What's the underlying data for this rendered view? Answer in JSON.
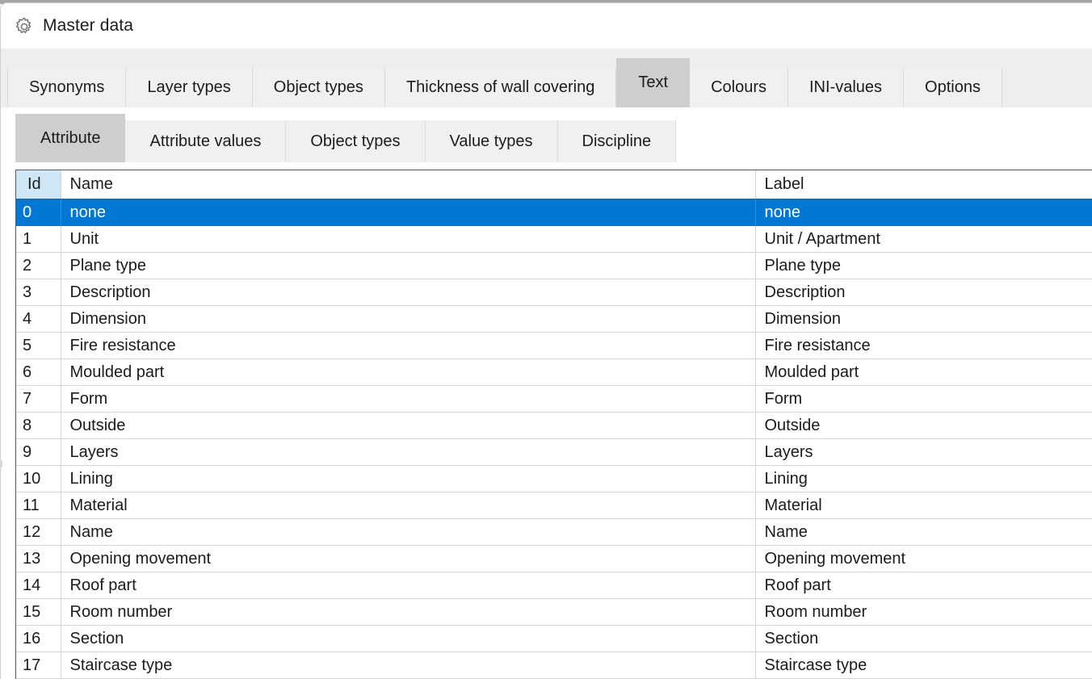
{
  "window": {
    "title": "Master data",
    "icon": "gear-icon"
  },
  "colors": {
    "selection_blue": "#0078d4",
    "header_id_blue": "#cfe6f7",
    "tab_selected_gray": "#cecece",
    "tab_gray": "#f0f0f0",
    "tabstrip_bg": "#eeeeee"
  },
  "tabs": {
    "selected": "Text",
    "items": [
      {
        "label": "Synonyms",
        "selected": false
      },
      {
        "label": "Layer types",
        "selected": false
      },
      {
        "label": "Object types",
        "selected": false
      },
      {
        "label": "Thickness of wall covering",
        "selected": false
      },
      {
        "label": "Text",
        "selected": true
      },
      {
        "label": "Colours",
        "selected": false
      },
      {
        "label": "INI-values",
        "selected": false
      },
      {
        "label": "Options",
        "selected": false
      }
    ]
  },
  "subtabs": {
    "selected": "Attribute",
    "items": [
      {
        "label": "Attribute",
        "selected": true
      },
      {
        "label": "Attribute values",
        "selected": false
      },
      {
        "label": "Object types",
        "selected": false
      },
      {
        "label": "Value types",
        "selected": false
      },
      {
        "label": "Discipline",
        "selected": false
      }
    ]
  },
  "grid": {
    "columns": [
      {
        "key": "id",
        "label": "Id"
      },
      {
        "key": "name",
        "label": "Name"
      },
      {
        "key": "label",
        "label": "Label"
      }
    ],
    "selected_row_index": 0,
    "rows": [
      {
        "id": "0",
        "name": "none",
        "label": "none"
      },
      {
        "id": "1",
        "name": "Unit",
        "label": "Unit / Apartment"
      },
      {
        "id": "2",
        "name": "Plane type",
        "label": "Plane type"
      },
      {
        "id": "3",
        "name": "Description",
        "label": "Description"
      },
      {
        "id": "4",
        "name": "Dimension",
        "label": "Dimension"
      },
      {
        "id": "5",
        "name": "Fire resistance",
        "label": "Fire resistance"
      },
      {
        "id": "6",
        "name": "Moulded part",
        "label": "Moulded part"
      },
      {
        "id": "7",
        "name": "Form",
        "label": "Form"
      },
      {
        "id": "8",
        "name": "Outside",
        "label": "Outside"
      },
      {
        "id": "9",
        "name": "Layers",
        "label": "Layers"
      },
      {
        "id": "10",
        "name": "Lining",
        "label": "Lining"
      },
      {
        "id": "11",
        "name": "Material",
        "label": "Material"
      },
      {
        "id": "12",
        "name": "Name",
        "label": "Name"
      },
      {
        "id": "13",
        "name": "Opening movement",
        "label": "Opening movement"
      },
      {
        "id": "14",
        "name": "Roof part",
        "label": "Roof part"
      },
      {
        "id": "15",
        "name": "Room number",
        "label": "Room number"
      },
      {
        "id": "16",
        "name": "Section",
        "label": "Section"
      },
      {
        "id": "17",
        "name": "Staircase type",
        "label": "Staircase type"
      }
    ]
  }
}
